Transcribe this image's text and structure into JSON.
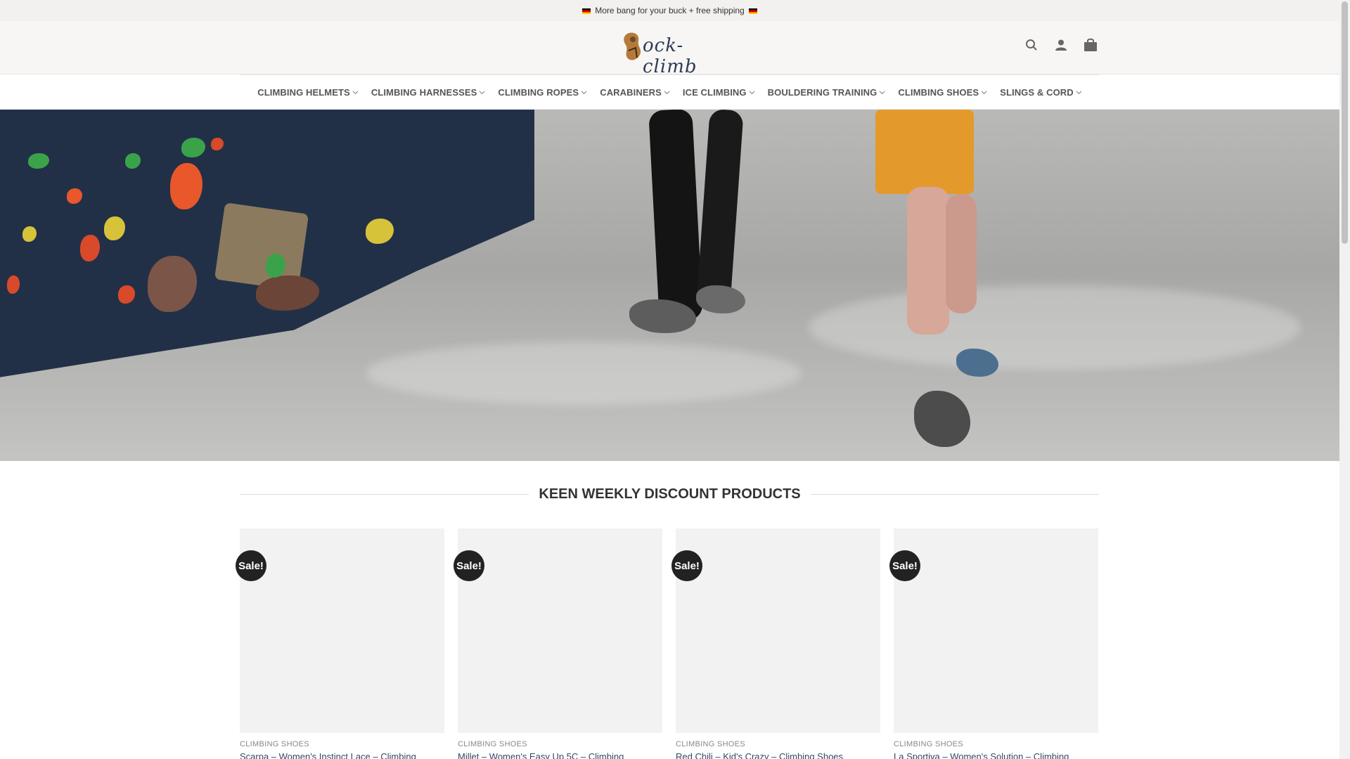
{
  "promo": {
    "text": "More bang for your buck + free shipping"
  },
  "logo": {
    "text": "rock-climb"
  },
  "header_icons": [
    "search-icon",
    "account-icon",
    "cart-icon"
  ],
  "nav": {
    "items": [
      {
        "label": "CLIMBING HELMETS"
      },
      {
        "label": "CLIMBING HARNESSES"
      },
      {
        "label": "CLIMBING ROPES"
      },
      {
        "label": "CARABINERS"
      },
      {
        "label": "ICE CLIMBING"
      },
      {
        "label": "BOULDERING TRAINING"
      },
      {
        "label": "CLIMBING SHOES"
      },
      {
        "label": "SLINGS & CORD"
      }
    ]
  },
  "section": {
    "title": "KEEN WEEKLY DISCOUNT PRODUCTS"
  },
  "products": [
    {
      "badge": "Sale!",
      "category": "CLIMBING SHOES",
      "title": "Scarpa – Women's Instinct Lace – Climbing"
    },
    {
      "badge": "Sale!",
      "category": "CLIMBING SHOES",
      "title": "Millet – Women's Easy Up 5C – Climbing"
    },
    {
      "badge": "Sale!",
      "category": "CLIMBING SHOES",
      "title": "Red Chili – Kid's Crazy – Climbing Shoes"
    },
    {
      "badge": "Sale!",
      "category": "CLIMBING SHOES",
      "title": "La Sportiva – Women's Solution – Climbing"
    }
  ],
  "colors": {
    "promo_bg": "#f3f1ef",
    "header_bg": "#f8f6f4",
    "badge_bg": "#222222",
    "link": "#334862"
  }
}
